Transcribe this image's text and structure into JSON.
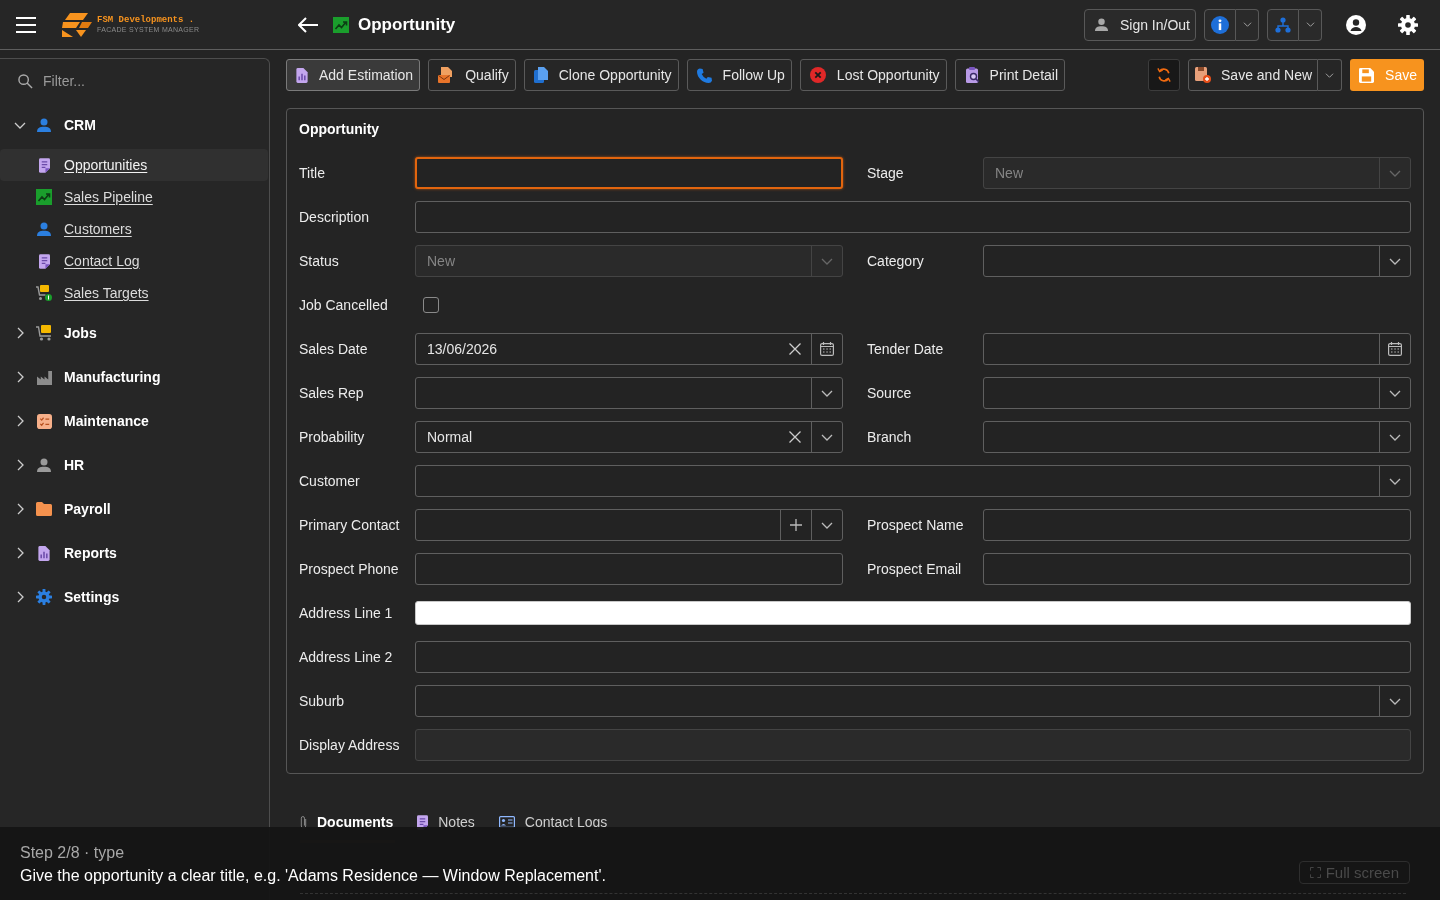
{
  "header": {
    "app_name": "FSM Developments .",
    "app_tagline": "FACADE SYSTEM MANAGER",
    "page_title": "Opportunity",
    "sign_button": "Sign In/Out"
  },
  "sidebar": {
    "filter_placeholder": "Filter...",
    "groups": [
      {
        "label": "CRM",
        "expanded": true,
        "children": [
          {
            "label": "Opportunities",
            "selected": true
          },
          {
            "label": "Sales Pipeline",
            "selected": false
          },
          {
            "label": "Customers",
            "selected": false
          },
          {
            "label": "Contact Log",
            "selected": false
          },
          {
            "label": "Sales Targets",
            "selected": false
          }
        ]
      },
      {
        "label": "Jobs",
        "expanded": false
      },
      {
        "label": "Manufacturing",
        "expanded": false
      },
      {
        "label": "Maintenance",
        "expanded": false
      },
      {
        "label": "HR",
        "expanded": false
      },
      {
        "label": "Payroll",
        "expanded": false
      },
      {
        "label": "Reports",
        "expanded": false
      },
      {
        "label": "Settings",
        "expanded": false
      }
    ]
  },
  "toolbar": {
    "actions": [
      {
        "label": "Add Estimation",
        "hovered": true
      },
      {
        "label": "Qualify",
        "hovered": false
      },
      {
        "label": "Clone Opportunity",
        "hovered": false
      },
      {
        "label": "Follow Up",
        "hovered": false
      },
      {
        "label": "Lost Opportunity",
        "hovered": false
      },
      {
        "label": "Print Detail",
        "hovered": false
      }
    ],
    "save_and_new": "Save and New",
    "save": "Save"
  },
  "form": {
    "title": "Opportunity",
    "rows": [
      [
        {
          "label": "Title",
          "kind": "text",
          "focused": true,
          "disabled": false,
          "autofilled": false
        },
        {
          "label": "Stage",
          "kind": "select",
          "value": "New",
          "focused": false,
          "disabled": true,
          "clearable": false,
          "addable": false
        }
      ],
      [
        {
          "label": "Description",
          "kind": "text",
          "focused": false,
          "disabled": false,
          "autofilled": false
        }
      ],
      [
        {
          "label": "Status",
          "kind": "select",
          "value": "New",
          "focused": false,
          "disabled": true,
          "clearable": false,
          "addable": false
        },
        {
          "label": "Category",
          "kind": "select",
          "focused": false,
          "disabled": false,
          "clearable": false,
          "addable": false
        }
      ],
      [
        {
          "label": "Job Cancelled",
          "kind": "checkbox",
          "checked": false
        }
      ],
      [
        {
          "label": "Sales Date",
          "kind": "date",
          "value": "13/06/2026",
          "focused": false,
          "disabled": false,
          "clearable": true
        },
        {
          "label": "Tender Date",
          "kind": "date",
          "focused": false,
          "disabled": false,
          "clearable": false
        }
      ],
      [
        {
          "label": "Sales Rep",
          "kind": "select",
          "focused": false,
          "disabled": false,
          "clearable": false,
          "addable": false
        },
        {
          "label": "Source",
          "kind": "select",
          "focused": false,
          "disabled": false,
          "clearable": false,
          "addable": false
        }
      ],
      [
        {
          "label": "Probability",
          "kind": "select",
          "value": "Normal",
          "focused": false,
          "disabled": false,
          "clearable": true,
          "addable": false
        },
        {
          "label": "Branch",
          "kind": "select",
          "focused": false,
          "disabled": false,
          "clearable": false,
          "addable": false
        }
      ],
      [
        {
          "label": "Customer",
          "kind": "select",
          "focused": false,
          "disabled": false,
          "clearable": false,
          "addable": false
        }
      ],
      [
        {
          "label": "Primary Contact",
          "kind": "select",
          "focused": false,
          "disabled": false,
          "clearable": false,
          "addable": true
        },
        {
          "label": "Prospect Name",
          "kind": "text",
          "focused": false,
          "disabled": false,
          "autofilled": false
        }
      ],
      [
        {
          "label": "Prospect Phone",
          "kind": "text",
          "focused": false,
          "disabled": false,
          "autofilled": false
        },
        {
          "label": "Prospect Email",
          "kind": "text",
          "focused": false,
          "disabled": false,
          "autofilled": false
        }
      ],
      [
        {
          "label": "Address Line 1",
          "kind": "text",
          "focused": false,
          "disabled": false,
          "autofilled": true
        }
      ],
      [
        {
          "label": "Address Line 2",
          "kind": "text",
          "focused": false,
          "disabled": false,
          "autofilled": false
        }
      ],
      [
        {
          "label": "Suburb",
          "kind": "select",
          "focused": false,
          "disabled": false,
          "clearable": false,
          "addable": false
        }
      ],
      [
        {
          "label": "Display Address",
          "kind": "text",
          "focused": false,
          "disabled": true,
          "autofilled": false
        }
      ]
    ]
  },
  "tabs": [
    {
      "label": "Documents",
      "selected": true
    },
    {
      "label": "Notes",
      "selected": false
    },
    {
      "label": "Contact Logs",
      "selected": false
    }
  ],
  "tutorial": {
    "step": "Step 2/8 · type",
    "instruction": "Give the opportunity a clear title, e.g. 'Adams Residence — Window Replacement'.",
    "full_screen_button": "Full screen"
  }
}
